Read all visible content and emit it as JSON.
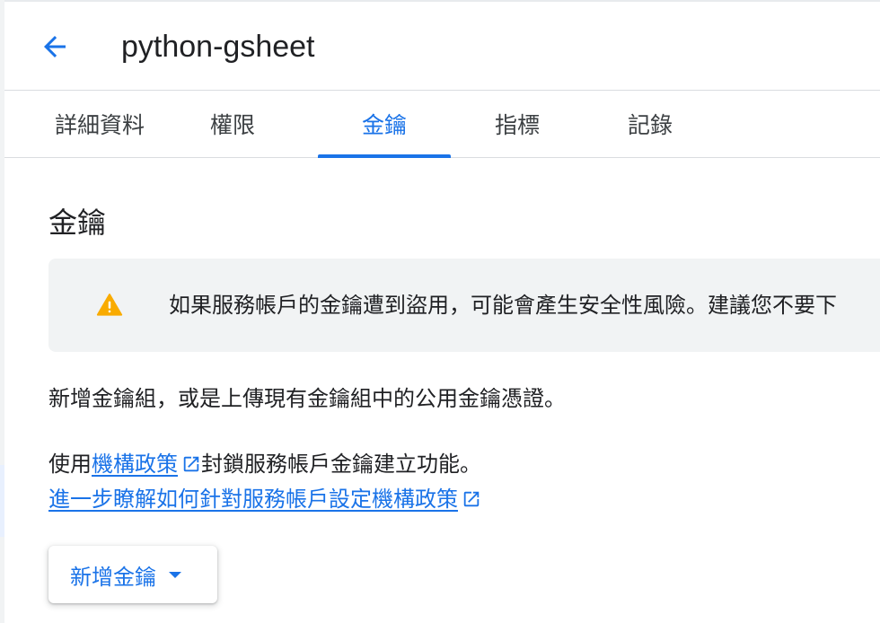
{
  "header": {
    "title": "python-gsheet",
    "back_icon": "arrow-back-icon"
  },
  "tabs": [
    {
      "label": "詳細資料",
      "active": false
    },
    {
      "label": "權限",
      "active": false
    },
    {
      "label": "金鑰",
      "active": true
    },
    {
      "label": "指標",
      "active": false
    },
    {
      "label": "記錄",
      "active": false
    }
  ],
  "section": {
    "title": "金鑰"
  },
  "banner": {
    "icon": "warning-icon",
    "text": "如果服務帳戶的金鑰遭到盜用，可能會產生安全性風險。建議您不要下"
  },
  "body": {
    "p1": "新增金鑰組，或是上傳現有金鑰組中的公用金鑰憑證。",
    "p2_prefix": "使用",
    "p2_link": "機構政策",
    "p2_suffix": "封鎖服務帳戶金鑰建立功能。",
    "p3_link": "進一步瞭解如何針對服務帳戶設定機構政策"
  },
  "add_key_button": {
    "label": "新增金鑰"
  },
  "colors": {
    "accent": "#1a73e8",
    "warning": "#f9ab00",
    "banner_bg": "#f1f3f4",
    "text": "#202124"
  }
}
